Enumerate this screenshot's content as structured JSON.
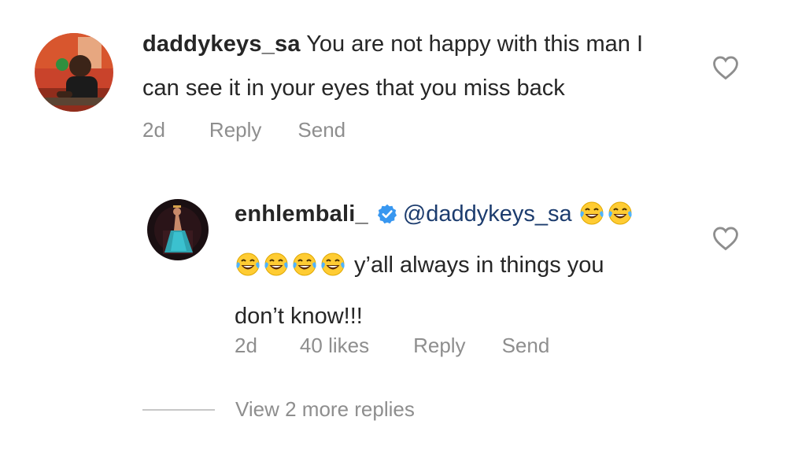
{
  "comment": {
    "username": "daddykeys_sa",
    "text_line1": "You are not happy with this man I",
    "text_line2": "can see it in your eyes that you miss back",
    "time": "2d",
    "reply_label": "Reply",
    "send_label": "Send",
    "like_icon": "heart-outline-icon"
  },
  "reply": {
    "username": "enhlembali_",
    "verified_icon": "verified-badge-icon",
    "mention": "@daddykeys_sa",
    "emoji_icon": "face-with-tears-of-joy",
    "text_line2": "y’all always in things you",
    "text_line3": "don’t know!!!",
    "time": "2d",
    "likes": "40 likes",
    "reply_label": "Reply",
    "send_label": "Send",
    "like_icon": "heart-outline-icon"
  },
  "view_more_replies": "View 2 more replies",
  "colors": {
    "text": "#262626",
    "muted": "#8e8e8e",
    "mention": "#1c3c6e",
    "verified": "#3897f0"
  }
}
